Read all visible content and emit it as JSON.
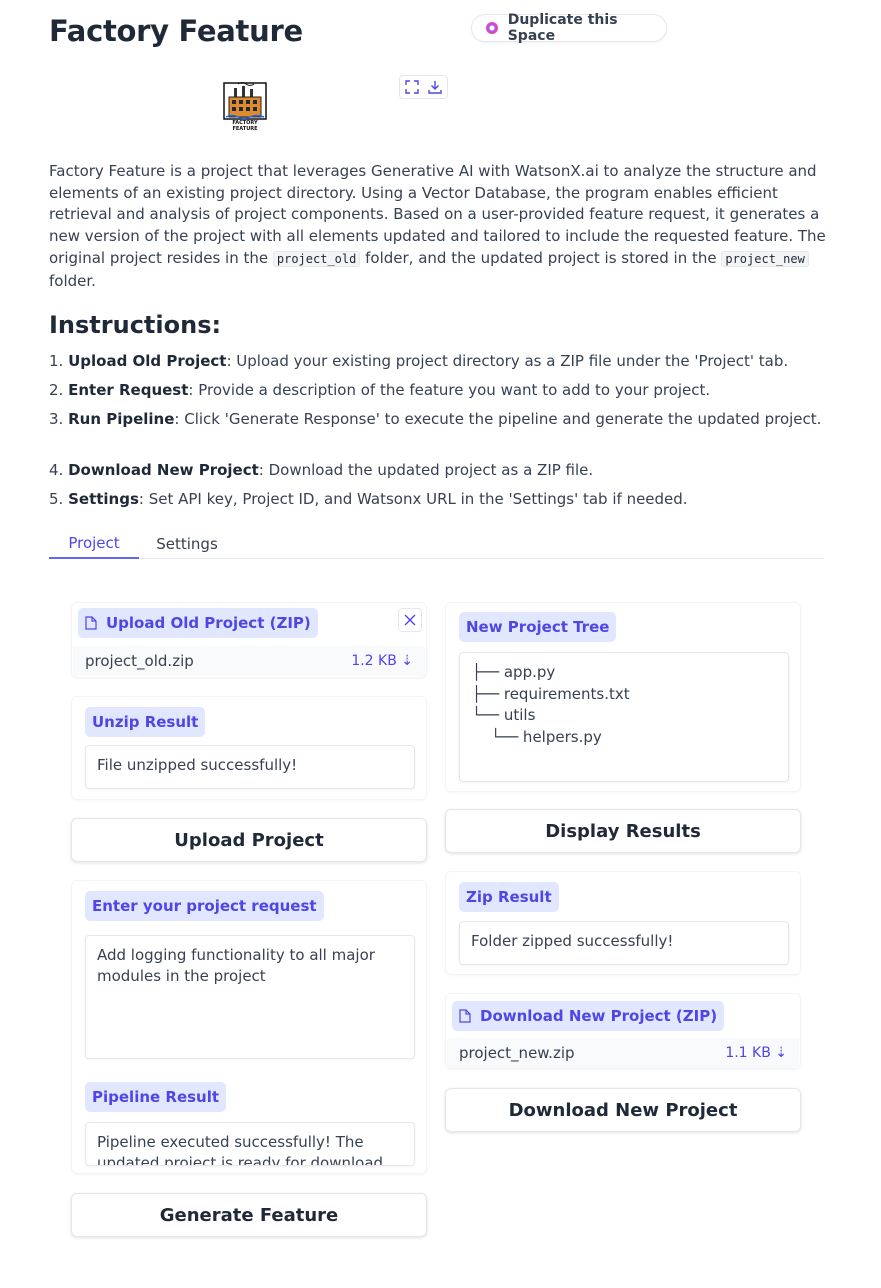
{
  "page": {
    "title": "Factory Feature",
    "duplicate_label": "Duplicate this Space",
    "logo_text": "FACTORY FEATURE"
  },
  "description": {
    "part1": "Factory Feature is a project that leverages Generative AI with WatsonX.ai to analyze the structure and elements of an existing project directory. Using a Vector Database, the program enables efficient retrieval and analysis of project components. Based on a user-provided feature request, it generates a new version of the project with all elements updated and tailored to include the requested feature. The original project resides in the ",
    "code1": "project_old",
    "part2": " folder, and the updated project is stored in the ",
    "code2": "project_new",
    "part3": " folder."
  },
  "instructions": {
    "title": "Instructions:",
    "items": [
      {
        "num": "1. ",
        "bold": "Upload Old Project",
        "text": ": Upload your existing project directory as a ZIP file under the 'Project' tab."
      },
      {
        "num": "2. ",
        "bold": "Enter Request",
        "text": ": Provide a description of the feature you want to add to your project."
      },
      {
        "num": "3. ",
        "bold": "Run Pipeline",
        "text": ": Click 'Generate Response' to execute the pipeline and generate the updated project."
      },
      {
        "num": "4. ",
        "bold": "Download New Project",
        "text": ": Download the updated project as a ZIP file."
      },
      {
        "num": "5. ",
        "bold": "Settings",
        "text": ": Set API key, Project ID, and Watsonx URL in the 'Settings' tab if needed."
      }
    ]
  },
  "tabs": [
    "Project",
    "Settings"
  ],
  "left": {
    "upload_label": "Upload Old Project (ZIP)",
    "upload_file": "project_old.zip",
    "upload_size": "1.2 KB ⇣",
    "unzip_label": "Unzip Result",
    "unzip_value": "File unzipped successfully!",
    "upload_button": "Upload Project",
    "request_label": "Enter your project request",
    "request_value": "Add logging functionality to all major modules in the project",
    "pipeline_label": "Pipeline Result",
    "pipeline_value": "Pipeline executed successfully! The updated project is ready for download.",
    "generate_button": "Generate Feature"
  },
  "right": {
    "tree_label": "New Project Tree",
    "tree_lines": [
      "├── app.py",
      "├── requirements.txt",
      "└── utils",
      "    └── helpers.py"
    ],
    "display_button": "Display Results",
    "zip_label": "Zip Result",
    "zip_value": "Folder zipped successfully!",
    "download_label": "Download New Project (ZIP)",
    "download_file": "project_new.zip",
    "download_size": "1.1 KB ⇣",
    "download_button": "Download New Project"
  },
  "colors": {
    "accent": "#4f46e5",
    "chip_bg": "#e0e7ff",
    "text": "#374151"
  }
}
